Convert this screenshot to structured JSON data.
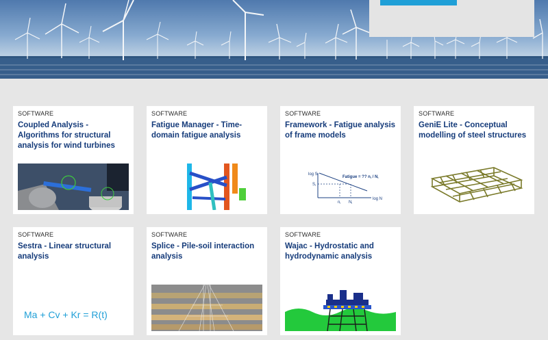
{
  "cards": [
    {
      "tag": "SOFTWARE",
      "title": "Coupled Analysis - Algorithms for structural analysis for wind turbines"
    },
    {
      "tag": "SOFTWARE",
      "title": "Fatigue Manager - Time-domain fatigue analysis"
    },
    {
      "tag": "SOFTWARE",
      "title": "Framework - Fatigue analysis of frame models"
    },
    {
      "tag": "SOFTWARE",
      "title": "GeniE Lite - Conceptual modelling of steel structures"
    },
    {
      "tag": "SOFTWARE",
      "title": "Sestra - Linear structural analysis"
    },
    {
      "tag": "SOFTWARE",
      "title": "Splice - Pile-soil interaction analysis"
    },
    {
      "tag": "SOFTWARE",
      "title": "Wajac - Hydrostatic and hydrodynamic analysis"
    }
  ],
  "fatigue_chart": {
    "y_axis_label": "log S",
    "x_axis_label": "log N",
    "equation": "Fatigue = ?? n",
    "equation_sub": "i",
    "equation_tail": " / N",
    "equation_tail_sub": "i",
    "s_label": "S",
    "s_sub": "i",
    "n_label": "n",
    "n_sub": "i",
    "N_label": "N",
    "N_sub": "i"
  },
  "sestra_formula": "Ma + Cv + Kr = R(t)",
  "colors": {
    "title_blue": "#153b7a",
    "accent_blue": "#1f9fd7",
    "page_gray": "#e6e6e6"
  }
}
